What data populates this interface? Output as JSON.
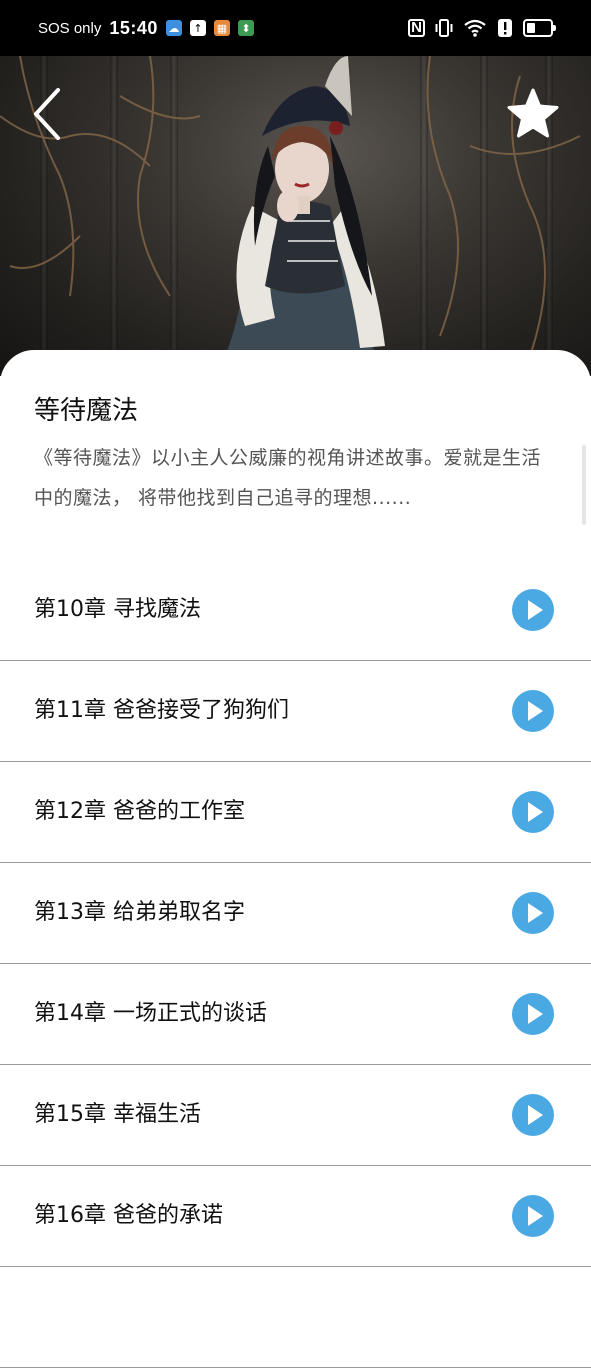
{
  "status_bar": {
    "carrier": "SOS only",
    "time": "15:40",
    "nfc": "N",
    "battery_level": 0.35
  },
  "header": {
    "back_icon": "chevron-left-icon",
    "favorite_icon": "star-icon"
  },
  "book": {
    "title": "等待魔法",
    "description": "《等待魔法》以小主人公威廉的视角讲述故事。爱就是生活中的魔法， 将带他找到自己追寻的理想......"
  },
  "chapters": [
    {
      "label": "第10章 寻找魔法"
    },
    {
      "label": "第11章 爸爸接受了狗狗们"
    },
    {
      "label": "第12章 爸爸的工作室"
    },
    {
      "label": "第13章 给弟弟取名字"
    },
    {
      "label": "第14章 一场正式的谈话"
    },
    {
      "label": "第15章 幸福生活"
    },
    {
      "label": "第16章 爸爸的承诺"
    },
    {
      "label": ""
    }
  ],
  "colors": {
    "play_button": "#4aa9e3",
    "divider": "#9a9a9a"
  }
}
